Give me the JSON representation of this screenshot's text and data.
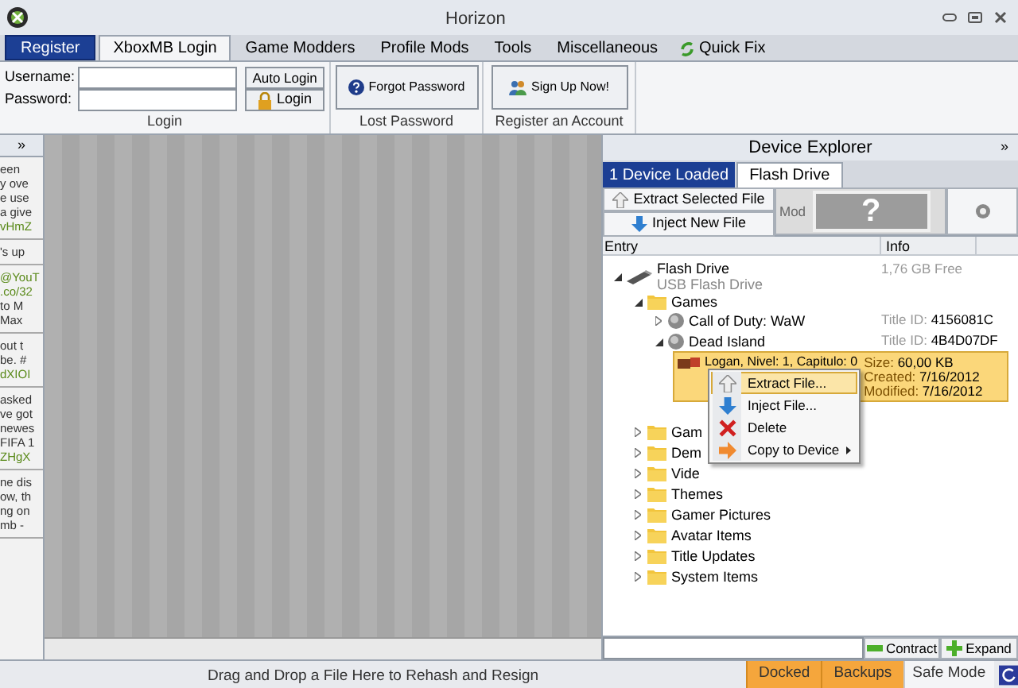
{
  "window": {
    "title": "Horizon"
  },
  "tabs": [
    {
      "label": "Register",
      "kind": "special",
      "selected": false
    },
    {
      "label": "XboxMB Login",
      "kind": "tab",
      "selected": true
    },
    {
      "label": "Game Modders",
      "kind": "tab",
      "selected": false
    },
    {
      "label": "Profile Mods",
      "kind": "tab",
      "selected": false
    },
    {
      "label": "Tools",
      "kind": "tab",
      "selected": false
    },
    {
      "label": "Miscellaneous",
      "kind": "tab",
      "selected": false
    },
    {
      "label": "Quick Fix",
      "kind": "quickfix",
      "selected": false
    }
  ],
  "login": {
    "username_label": "Username:",
    "password_label": "Password:",
    "auto_login": "Auto Login",
    "login": "Login",
    "group": "Login"
  },
  "lost_password": {
    "button": "Forgot Password",
    "group": "Lost Password"
  },
  "register": {
    "button": "Sign Up Now!",
    "group": "Register an Account"
  },
  "feed": {
    "toggle": "»",
    "posts": [
      {
        "lines": [
          {
            "text": "een",
            "link": false
          },
          {
            "text": "y ove",
            "link": false
          },
          {
            "text": "e use",
            "link": false
          },
          {
            "text": "a give",
            "link": false
          },
          {
            "text": "vHmZ",
            "link": true
          }
        ]
      },
      {
        "lines": [
          {
            "text": "'s up",
            "link": false
          }
        ]
      },
      {
        "lines": [
          {
            "text": "@YouT",
            "link": true
          },
          {
            "text": ".co/32",
            "link": true
          },
          {
            "text": "to M",
            "link": false
          },
          {
            "text": "Max",
            "link": false
          }
        ]
      },
      {
        "lines": [
          {
            "text": "out t",
            "link": false
          },
          {
            "text": "be. #",
            "link": false
          },
          {
            "text": "dXIOI",
            "link": true
          }
        ]
      },
      {
        "lines": [
          {
            "text": "asked",
            "link": false
          },
          {
            "text": "ve got",
            "link": false
          },
          {
            "text": "newes",
            "link": false
          },
          {
            "text": "FIFA 1",
            "link": false
          },
          {
            "text": "ZHgX",
            "link": true
          }
        ]
      },
      {
        "lines": [
          {
            "text": "ne dis",
            "link": false
          },
          {
            "text": "ow, th",
            "link": false
          },
          {
            "text": "ng on",
            "link": false
          },
          {
            "text": "mb -",
            "link": false
          }
        ]
      }
    ]
  },
  "device_explorer": {
    "title": "Device Explorer",
    "toggle": "»",
    "tabs": [
      {
        "label": "1 Device Loaded",
        "kind": "status",
        "selected": false
      },
      {
        "label": "Flash Drive",
        "kind": "tab",
        "selected": true
      }
    ],
    "extract_button": "Extract Selected File",
    "inject_button": "Inject New File",
    "mod_label": "Mod",
    "mod_preview": "?",
    "columns": [
      "Entry",
      "Info"
    ],
    "tree": [
      {
        "label": "Flash Drive",
        "sublabel": "USB Flash Drive",
        "kind": "drive",
        "expanded": true,
        "selected": false,
        "info": [
          {
            "label": "1,76 GB Free"
          }
        ],
        "children": [
          {
            "label": "Games",
            "kind": "folder",
            "expanded": true,
            "selected": false,
            "children": [
              {
                "label": "Call of Duty: WaW",
                "kind": "game",
                "expanded": false,
                "selected": false,
                "info": [
                  {
                    "label": "Title ID:",
                    "value": "4156081C"
                  }
                ]
              },
              {
                "label": "Dead Island",
                "kind": "game",
                "expanded": true,
                "selected": false,
                "info": [
                  {
                    "label": "Title ID:",
                    "value": "4B4D07DF"
                  }
                ],
                "children": [
                  {
                    "label": "Logan, Nivel: 1, Capitulo: 0",
                    "kind": "save",
                    "selected": true,
                    "info": [
                      {
                        "label": "Size:",
                        "value": "60,00 KB"
                      },
                      {
                        "label": "Created:",
                        "value": "7/16/2012"
                      },
                      {
                        "label": "Modified:",
                        "value": "7/16/2012"
                      }
                    ]
                  }
                ]
              }
            ]
          },
          {
            "label": "Gam",
            "kind": "folder",
            "expanded": false,
            "selected": false
          },
          {
            "label": "Dem",
            "kind": "folder",
            "expanded": false,
            "selected": false
          },
          {
            "label": "Vide",
            "kind": "folder",
            "expanded": false,
            "selected": false
          },
          {
            "label": "Themes",
            "kind": "folder",
            "expanded": false,
            "selected": false
          },
          {
            "label": "Gamer Pictures",
            "kind": "folder",
            "expanded": false,
            "selected": false
          },
          {
            "label": "Avatar Items",
            "kind": "folder",
            "expanded": false,
            "selected": false
          },
          {
            "label": "Title Updates",
            "kind": "folder",
            "expanded": false,
            "selected": false
          },
          {
            "label": "System Items",
            "kind": "folder",
            "expanded": false,
            "selected": false
          }
        ]
      }
    ],
    "context_menu": [
      {
        "label": "Extract File...",
        "kind": "extract",
        "selected": true,
        "submenu": false
      },
      {
        "label": "Inject File...",
        "kind": "inject",
        "selected": false,
        "submenu": false
      },
      {
        "label": "Delete",
        "kind": "delete",
        "selected": false,
        "submenu": false
      },
      {
        "label": "Copy to Device",
        "kind": "copy",
        "selected": false,
        "submenu": true
      }
    ],
    "contract_button": "Contract",
    "expand_button": "Expand"
  },
  "status_bar": {
    "message": "Drag and Drop a File Here to Rehash and Resign",
    "items": [
      {
        "label": "Docked",
        "on": true
      },
      {
        "label": "Backups",
        "on": true
      },
      {
        "label": "Safe Mode",
        "on": false
      }
    ]
  }
}
